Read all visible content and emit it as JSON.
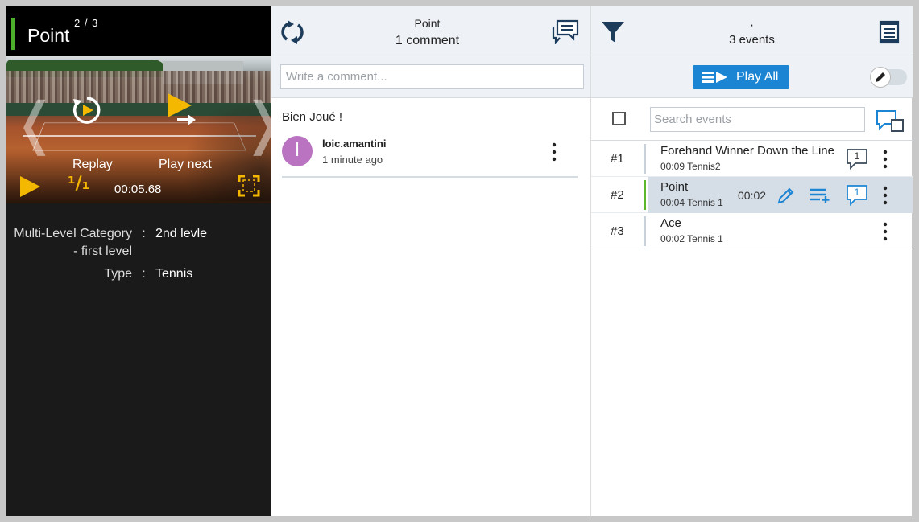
{
  "player": {
    "title": "Point",
    "counter": "2 / 3",
    "replay_label": "Replay",
    "play_next_label": "Play next",
    "speed": "¹/₁",
    "time": "00:05.68",
    "prev_glyph": "❬",
    "next_glyph": "❭",
    "accent_color": "#f5b800",
    "category_color": "#4caf2a"
  },
  "metadata": [
    {
      "key": "Multi-Level Category - first level",
      "value": "2nd levle"
    },
    {
      "key": "Type",
      "value": "Tennis"
    }
  ],
  "meta_separator": ":",
  "comments_panel": {
    "title": "Point",
    "subtitle": "1 comment",
    "input_placeholder": "Write a comment...",
    "comments": [
      {
        "text": "Bien Joué !",
        "avatar_letter": "l",
        "author": "loic.amantini",
        "ago": "1 minute ago",
        "avatar_color": "#b973c0"
      }
    ]
  },
  "events_panel": {
    "filter_title": ",",
    "count_label": "3 events",
    "play_all_label": "Play All",
    "search_placeholder": "Search events",
    "primary_color": "#1b85d4",
    "events": [
      {
        "num": "#1",
        "title": "Forehand Winner Down the Line",
        "sub": "00:09 Tennis2",
        "duration": "",
        "comments": "1",
        "selected": false
      },
      {
        "num": "#2",
        "title": "Point",
        "sub": "00:04 Tennis 1",
        "duration": "00:02",
        "comments": "1",
        "selected": true
      },
      {
        "num": "#3",
        "title": "Ace",
        "sub": "00:02 Tennis 1",
        "duration": "",
        "comments": "",
        "selected": false
      }
    ]
  },
  "icons": [
    "refresh-icon",
    "comments-icon",
    "filter-icon",
    "list-icon",
    "replay-icon",
    "play-next-icon",
    "play-icon",
    "fullscreen-icon",
    "edit-icon",
    "add-to-list-icon",
    "comment-icon",
    "more-icon"
  ]
}
